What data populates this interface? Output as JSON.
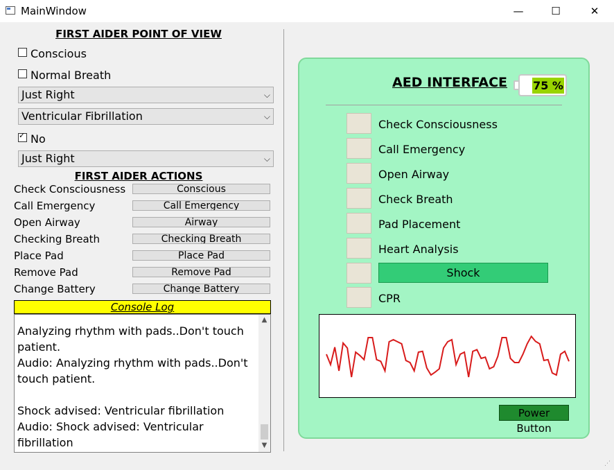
{
  "window": {
    "title": "MainWindow",
    "minimize": "—",
    "maximize": "☐",
    "close": "✕"
  },
  "left": {
    "pov_heading": "FIRST AIDER POINT OF VIEW",
    "conscious_label": "Conscious",
    "conscious_checked": false,
    "normal_breath_label": "Normal Breath",
    "normal_breath_checked": false,
    "combo1": "Just Right",
    "combo2": "Ventricular Fibrillation",
    "no_label": "No",
    "no_checked": true,
    "combo3": "Just Right",
    "actions_heading": "FIRST AIDER ACTIONS",
    "actions": [
      {
        "label": "Check Consciousness",
        "button": "Conscious"
      },
      {
        "label": "Call Emergency",
        "button": "Call Emergency"
      },
      {
        "label": "Open Airway",
        "button": "Airway"
      },
      {
        "label": "Checking Breath",
        "button": "Checking Breath"
      },
      {
        "label": "Place Pad",
        "button": "Place Pad"
      },
      {
        "label": "Remove Pad",
        "button": "Remove Pad"
      },
      {
        "label": "Change Battery",
        "button": "Change Battery"
      }
    ],
    "console_title": "Console Log",
    "console_text": "Analyzing rhythm with pads..Don't touch patient.\nAudio: Analyzing rhythm with pads..Don't touch patient.\n\nShock advised: Ventricular fibrillation\nAudio: Shock advised: Ventricular fibrillation"
  },
  "aed": {
    "title": "AED INTERFACE",
    "battery": "75 %",
    "battery_level": 0.75,
    "steps": [
      {
        "label": "Check Consciousness",
        "icon": "check-consciousness-icon"
      },
      {
        "label": "Call Emergency",
        "icon": "call-emergency-icon"
      },
      {
        "label": "Open Airway",
        "icon": "open-airway-icon"
      },
      {
        "label": "Check Breath",
        "icon": "check-breath-icon"
      },
      {
        "label": "Pad Placement",
        "icon": "pad-placement-icon"
      },
      {
        "label": "Heart Analysis",
        "icon": "heart-analysis-icon"
      },
      {
        "label": "Shock",
        "icon": "shock-icon"
      },
      {
        "label": "CPR",
        "icon": "cpr-icon"
      }
    ],
    "ecg_values": [
      0.55,
      0.3,
      0.72,
      0.15,
      0.82,
      0.7,
      0.0,
      0.6,
      0.52,
      0.42,
      0.95,
      0.95,
      0.42,
      0.38,
      0.15,
      0.85,
      0.9,
      0.85,
      0.8,
      0.4,
      0.35,
      0.15,
      0.6,
      0.62,
      0.22,
      0.05,
      0.12,
      0.2,
      0.7,
      0.85,
      0.9,
      0.3,
      0.55,
      0.6,
      0.0,
      0.62,
      0.66,
      0.45,
      0.48,
      0.2,
      0.25,
      0.5,
      0.95,
      0.95,
      0.45,
      0.35,
      0.35,
      0.55,
      0.8,
      0.98,
      0.86,
      0.8,
      0.4,
      0.42,
      0.1,
      0.05,
      0.55,
      0.62,
      0.38
    ],
    "ecg_color": "#d81b1b",
    "power_button": "Power Button",
    "panel_color": "#a3f5c4",
    "shock_color": "#33cc77"
  }
}
